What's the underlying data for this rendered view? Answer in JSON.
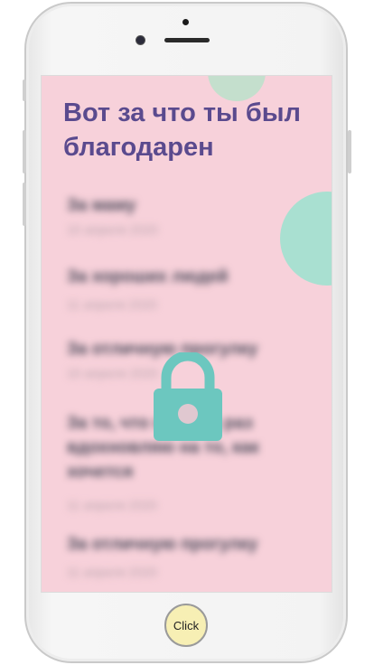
{
  "screen": {
    "title": "Вот за что ты был благодарен",
    "items": [
      {
        "text": "За маму",
        "date": "10 апреля 2020"
      },
      {
        "text": "За хороших людей",
        "date": "11 апреля 2020"
      },
      {
        "text": "За отличную прогулку",
        "date": "10 апреля 2020"
      },
      {
        "text": "За то, что я много раз вдохновляю на то, как хочется",
        "date": "11 апреля 2020"
      },
      {
        "text": "За отличную прогулку",
        "date": "11 апреля 2020"
      }
    ],
    "lock_icon": "lock-icon"
  },
  "device": {
    "home_button_label": "Click"
  },
  "colors": {
    "background": "#f7d1da",
    "title": "#5a4a8e",
    "lock": "#6cc7bf",
    "home_button": "#f7efb4"
  }
}
